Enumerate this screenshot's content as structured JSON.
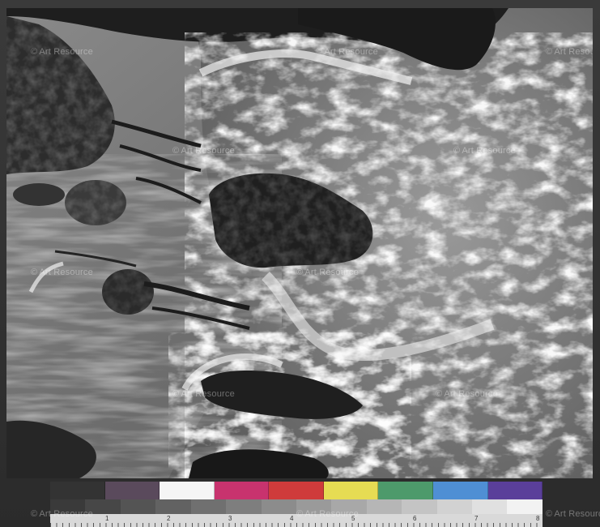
{
  "watermark": {
    "text": "Art Resource"
  },
  "color_target": {
    "swatches": [
      "#333333",
      "#5a4a5c",
      "#f5f5f5",
      "#c8336e",
      "#cf3b3b",
      "#e6dc53",
      "#4d9a6b",
      "#4f8fd4",
      "#5a3f9a"
    ],
    "grays": [
      "#3a3a3a",
      "#474747",
      "#545454",
      "#626262",
      "#707070",
      "#7e7e7e",
      "#8c8c8c",
      "#9a9a9a",
      "#a8a8a8",
      "#b6b6b6",
      "#c4c4c4",
      "#d2d2d2",
      "#e0e0e0",
      "#f2f2f2"
    ],
    "ruler_numbers": [
      "1",
      "2",
      "3",
      "4",
      "5",
      "6",
      "7",
      "8"
    ]
  }
}
